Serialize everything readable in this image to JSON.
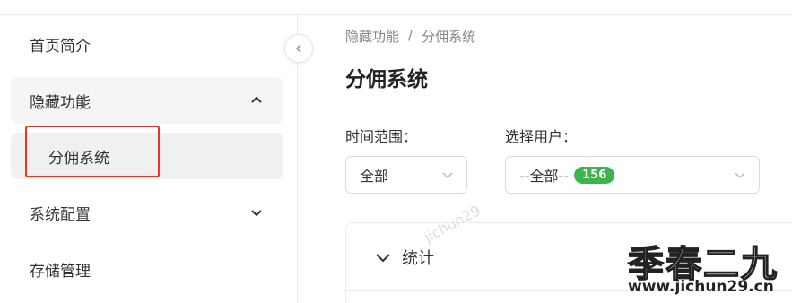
{
  "sidebar": {
    "items": [
      {
        "label": "首页简介"
      },
      {
        "label": "隐藏功能"
      },
      {
        "label": "分佣系统"
      },
      {
        "label": "系统配置"
      },
      {
        "label": "存储管理"
      }
    ]
  },
  "breadcrumb": {
    "parent": "隐藏功能",
    "separator": "/",
    "current": "分佣系统"
  },
  "page": {
    "title": "分佣系统"
  },
  "filters": {
    "time_label": "时间范围：",
    "time_value": "全部",
    "user_label": "选择用户：",
    "user_value": "--全部--",
    "user_count": "156"
  },
  "card": {
    "title": "统计"
  },
  "watermark": {
    "diagonal": "jichun29",
    "logo": "季春二九",
    "url": "www.jichun29.cn"
  },
  "colors": {
    "highlight": "#e8352a",
    "badge": "#3cb54a"
  }
}
